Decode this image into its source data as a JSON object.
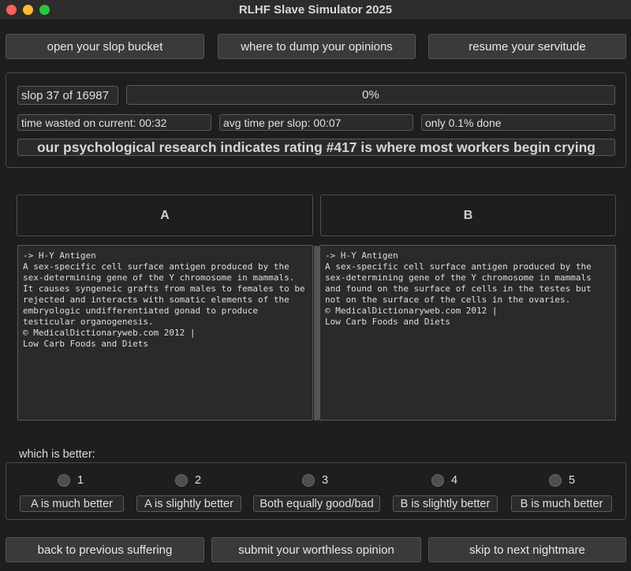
{
  "window": {
    "title": "RLHF Slave Simulator 2025"
  },
  "toolbar": {
    "open": "open your slop bucket",
    "dump": "where to dump your opinions",
    "resume": "resume your servitude"
  },
  "status": {
    "counter": "slop 37 of 16987",
    "progress_text": "0%",
    "progress_fraction": 0.0,
    "time_current": "time wasted on current: 00:32",
    "avg_time": "avg time per slop: 00:07",
    "done": "only 0.1% done",
    "banner": "our psychological research indicates rating #417 is where most workers begin crying"
  },
  "compare": {
    "a_label": "A",
    "b_label": "B",
    "a_text": "-> H-Y Antigen\nA sex-specific cell surface antigen produced by the sex-determining gene of the Y chromosome in mammals. It causes syngeneic grafts from males to females to be rejected and interacts with somatic elements of the embryologic undifferentiated gonad to produce testicular organogenesis.\n© MedicalDictionaryweb.com 2012 |\nLow Carb Foods and Diets",
    "b_text": "-> H-Y Antigen\nA sex-specific cell surface antigen produced by the sex-determining gene of the Y chromosome in mammals and found on the surface of cells in the testes but not on the surface of the cells in the ovaries.\n© MedicalDictionaryweb.com 2012 |\nLow Carb Foods and Diets"
  },
  "rating": {
    "prompt": "which is better:",
    "options": [
      {
        "num": "1",
        "label": "A is much better"
      },
      {
        "num": "2",
        "label": "A is slightly better"
      },
      {
        "num": "3",
        "label": "Both equally good/bad"
      },
      {
        "num": "4",
        "label": "B is slightly better"
      },
      {
        "num": "5",
        "label": "B is much better"
      }
    ]
  },
  "footer": {
    "back": "back to previous suffering",
    "submit": "submit your worthless opinion",
    "skip": "skip to next nightmare"
  },
  "colors": {
    "close": "#ff5f57",
    "minimize": "#febc2e",
    "zoom": "#28c840",
    "background": "#1e1e1e"
  }
}
